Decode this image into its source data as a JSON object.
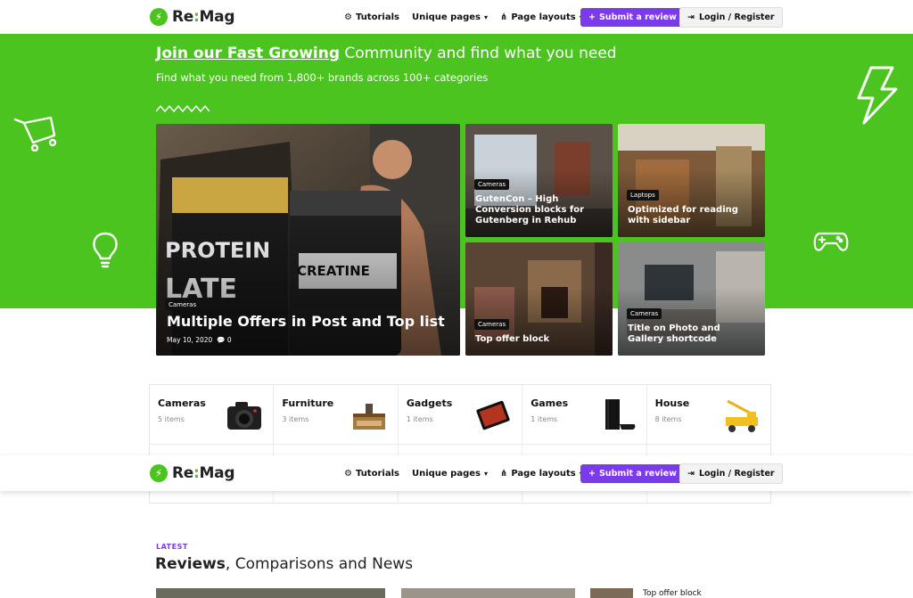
{
  "brand": {
    "logo_prefix": "Re",
    "logo_sep": ":",
    "logo_suffix": "Mag"
  },
  "nav": {
    "tutorials": "Tutorials",
    "unique_pages": "Unique pages",
    "page_layouts": "Page layouts",
    "submit_review": "Submit a review",
    "login": "Login / Register"
  },
  "hero": {
    "title_link": "Join our Fast Growing",
    "title_rest": " Community and find what you need",
    "subtitle": "Find what you need from 1,800+ brands across 100+ categories"
  },
  "posts": [
    {
      "tag": "Cameras",
      "title": "Multiple Offers in Post and Top list",
      "date": "May 10, 2020",
      "comments": "0"
    },
    {
      "tag": "Cameras",
      "title": "GutenCon – High Conversion blocks for Gutenberg in Rehub"
    },
    {
      "tag": "Laptops",
      "title": "Optimized for reading with sidebar"
    },
    {
      "tag": "Cameras",
      "title": "Top offer block"
    },
    {
      "tag": "Cameras",
      "title": "Title on Photo and Gallery shortcode"
    }
  ],
  "categories": [
    {
      "name": "Cameras",
      "count": "5 items",
      "icon": "camera-icon"
    },
    {
      "name": "Furniture",
      "count": "3 items",
      "icon": "furniture-icon"
    },
    {
      "name": "Gadgets",
      "count": "1 items",
      "icon": "tablet-icon"
    },
    {
      "name": "Games",
      "count": "1 items",
      "icon": "game-console-icon"
    },
    {
      "name": "House",
      "count": "8 items",
      "icon": "toy-truck-icon"
    }
  ],
  "latest": {
    "label": "LATEST",
    "title_bold": "Reviews",
    "title_rest": ", Comparisons and News",
    "teaser": "Top offer block"
  },
  "colors": {
    "brand_green": "#4bc41f",
    "accent_purple": "#7c3aed"
  }
}
